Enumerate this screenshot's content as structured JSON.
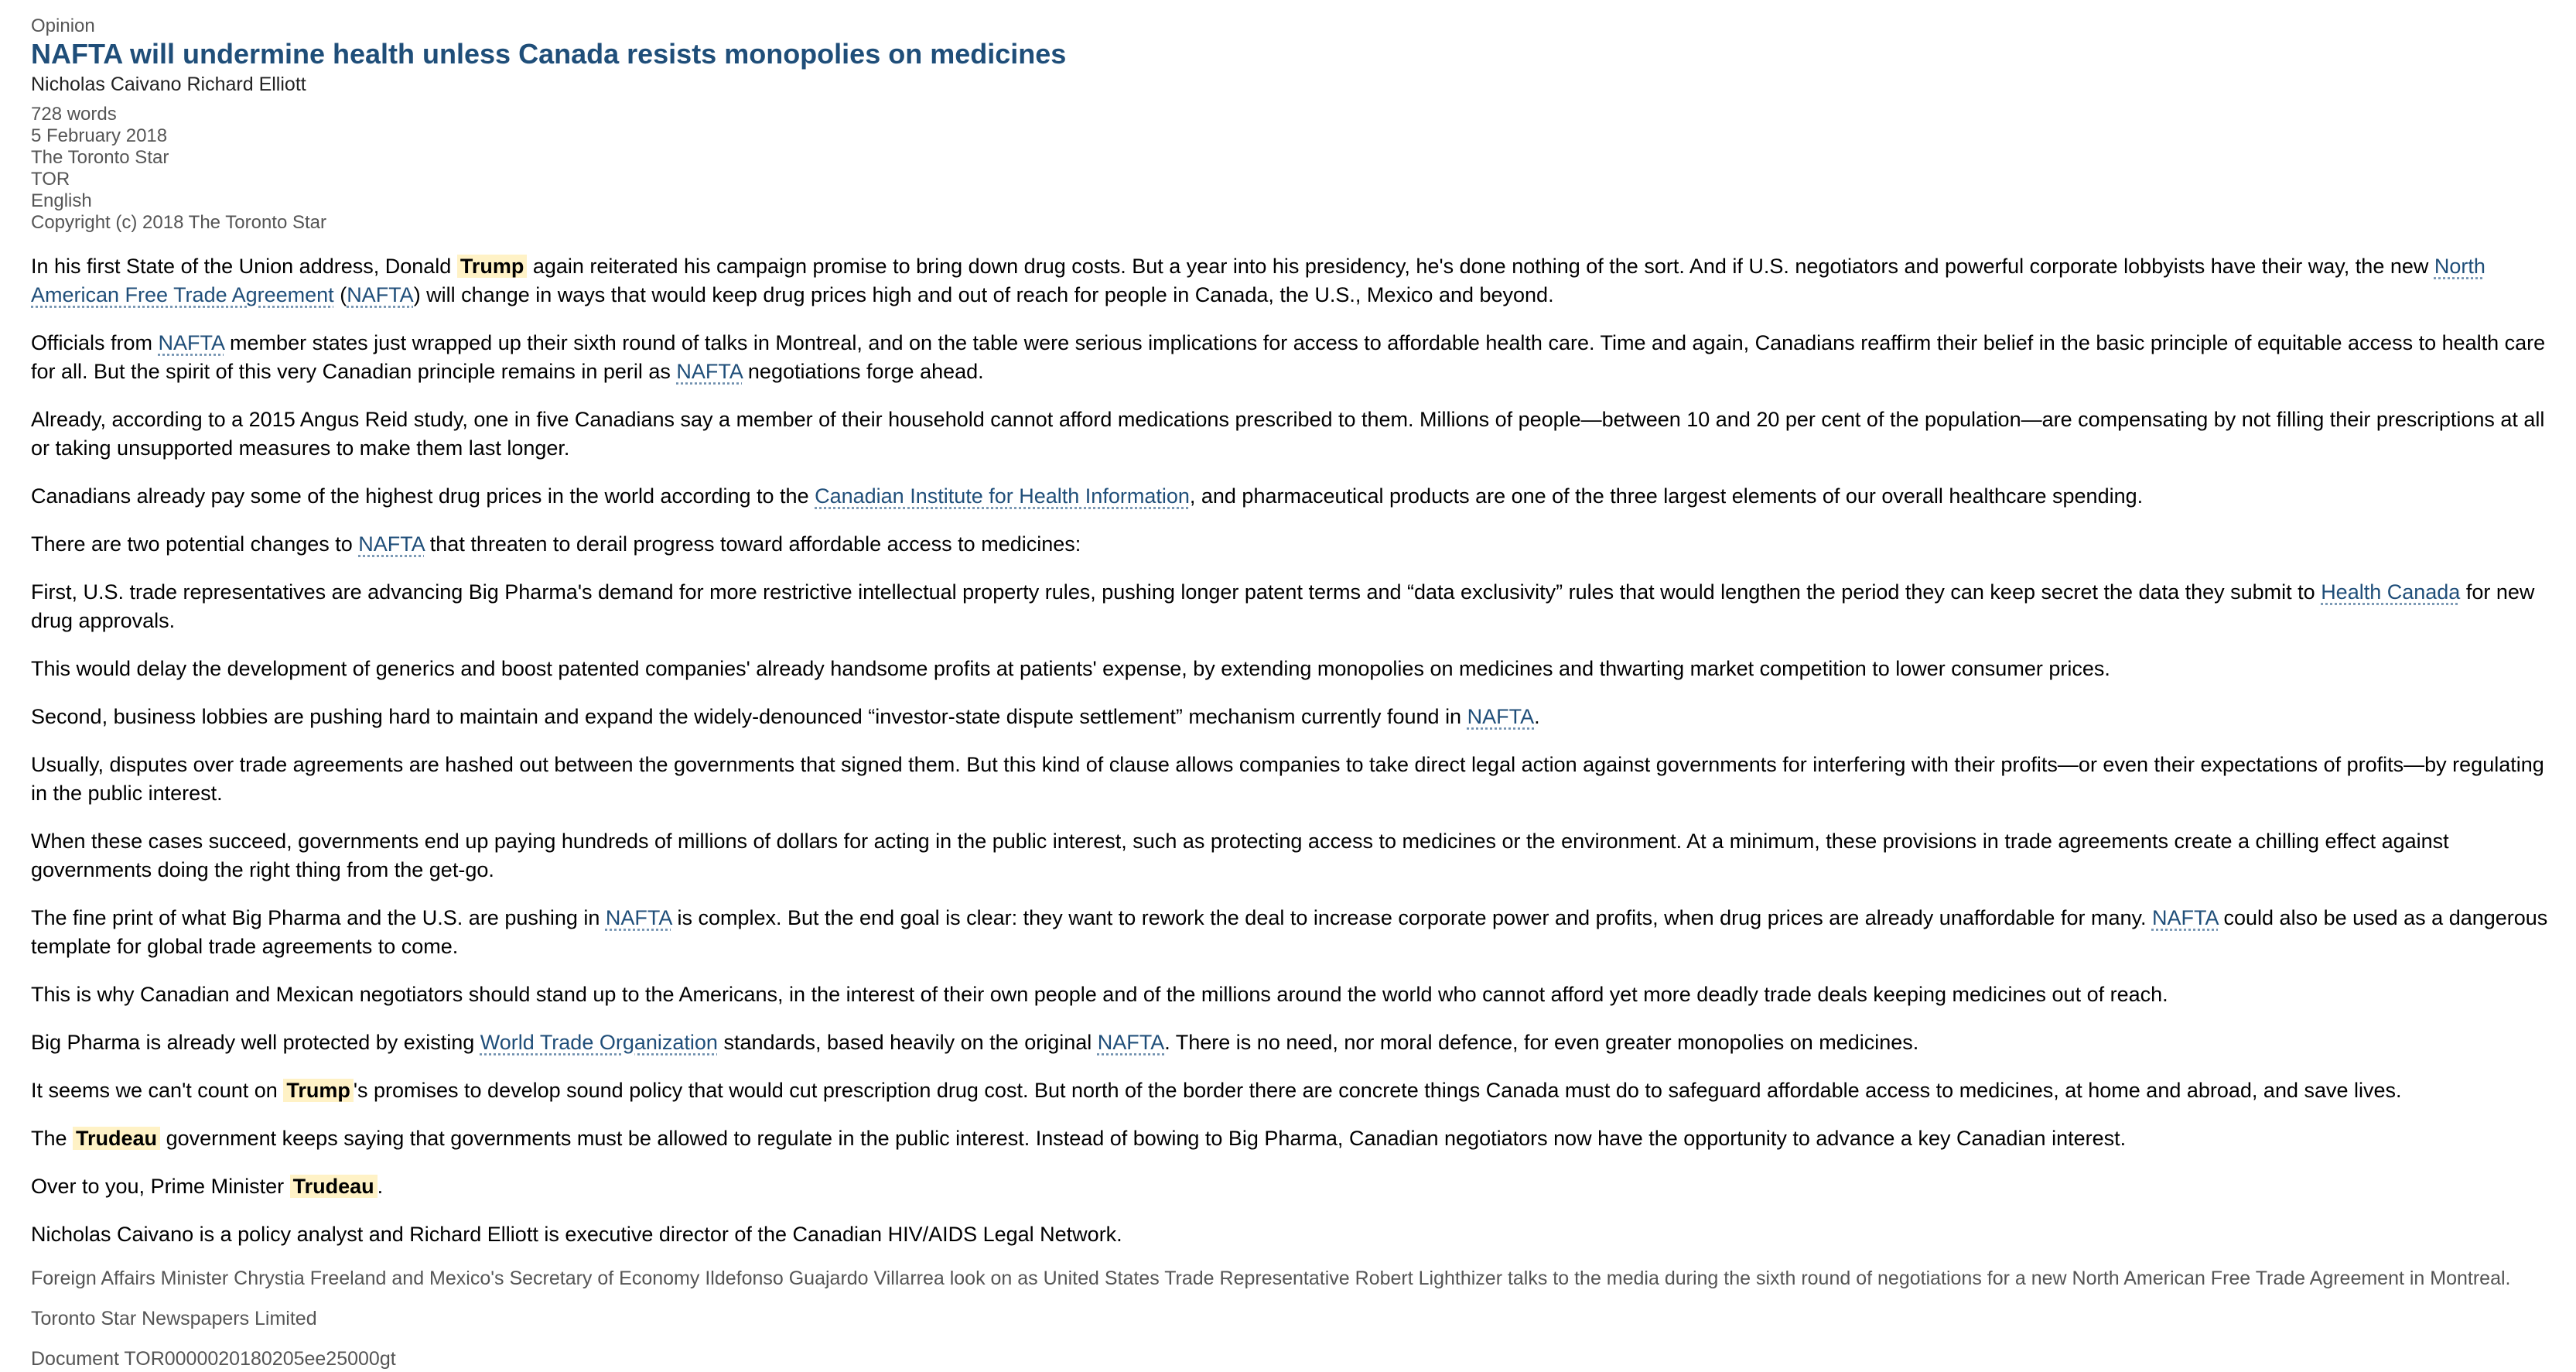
{
  "article": {
    "section": "Opinion",
    "headline": "NAFTA will undermine health unless Canada resists monopolies on medicines",
    "byline": "Nicholas Caivano Richard Elliott",
    "meta": {
      "word_count": "728 words",
      "date": "5 February 2018",
      "publication": "The Toronto Star",
      "source_code": "TOR",
      "language": "English",
      "copyright": "Copyright (c) 2018 The Toronto Star"
    },
    "paragraphs": {
      "p1": {
        "t1": "In his first State of the Union address, Donald ",
        "hl1": "Trump",
        "t2": " again reiterated his campaign promise to bring down drug costs. But a year into his presidency, he's done nothing of the sort. And if U.S. negotiators and powerful corporate lobbyists have their way, the new ",
        "link1": "North American Free Trade Agreement",
        "t3": " (",
        "link2": "NAFTA",
        "t4": ") will change in ways that would keep drug prices high and out of reach for people in Canada, the U.S., Mexico and beyond."
      },
      "p2": {
        "t1": "Officials from ",
        "link1": "NAFTA",
        "t2": " member states just wrapped up their sixth round of talks in Montreal, and on the table were serious implications for access to affordable health care. Time and again, Canadians reaffirm their belief in the basic principle of equitable access to health care for all. But the spirit of this very Canadian principle remains in peril as ",
        "link2": "NAFTA",
        "t3": " negotiations forge ahead."
      },
      "p3": {
        "t1": "Already, according to a 2015 Angus Reid study, one in five Canadians say a member of their household cannot afford medications prescribed to them. Millions of people—between 10 and 20 per cent of the population—are compensating by not filling their prescriptions at all or taking unsupported measures to make them last longer."
      },
      "p4": {
        "t1": "Canadians already pay some of the highest drug prices in the world according to the ",
        "link1": "Canadian Institute for Health Information",
        "t2": ", and pharmaceutical products are one of the three largest elements of our overall healthcare spending."
      },
      "p5": {
        "t1": "There are two potential changes to ",
        "link1": "NAFTA",
        "t2": " that threaten to derail progress toward affordable access to medicines:"
      },
      "p6": {
        "t1": "First, U.S. trade representatives are advancing Big Pharma's demand for more restrictive intellectual property rules, pushing longer patent terms and “data exclusivity” rules that would lengthen the period they can keep secret the data they submit to ",
        "link1": "Health Canada",
        "t2": " for new drug approvals."
      },
      "p7": {
        "t1": "This would delay the development of generics and boost patented companies' already handsome profits at patients' expense, by extending monopolies on medicines and thwarting market competition to lower consumer prices."
      },
      "p8": {
        "t1": "Second, business lobbies are pushing hard to maintain and expand the widely-denounced “investor-state dispute settlement” mechanism currently found in ",
        "link1": "NAFTA",
        "t2": "."
      },
      "p9": {
        "t1": "Usually, disputes over trade agreements are hashed out between the governments that signed them. But this kind of clause allows companies to take direct legal action against governments for interfering with their profits—or even their expectations of profits—by regulating in the public interest."
      },
      "p10": {
        "t1": "When these cases succeed, governments end up paying hundreds of millions of dollars for acting in the public interest, such as protecting access to medicines or the environment. At a minimum, these provisions in trade agreements create a chilling effect against governments doing the right thing from the get-go."
      },
      "p11": {
        "t1": "The fine print of what Big Pharma and the U.S. are pushing in ",
        "link1": "NAFTA",
        "t2": " is complex. But the end goal is clear: they want to rework the deal to increase corporate power and profits, when drug prices are already unaffordable for many. ",
        "link2": "NAFTA",
        "t3": " could also be used as a dangerous template for global trade agreements to come."
      },
      "p12": {
        "t1": "This is why Canadian and Mexican negotiators should stand up to the Americans, in the interest of their own people and of the millions around the world who cannot afford yet more deadly trade deals keeping medicines out of reach."
      },
      "p13": {
        "t1": "Big Pharma is already well protected by existing ",
        "link1": "World Trade Organization",
        "t2": " standards, based heavily on the original ",
        "link2": "NAFTA",
        "t3": ". There is no need, nor moral defence, for even greater monopolies on medicines."
      },
      "p14": {
        "t1": "It seems we can't count on ",
        "hl1": "Trump",
        "t2": "'s promises to develop sound policy that would cut prescription drug cost. But north of the border there are concrete things Canada must do to safeguard affordable access to medicines, at home and abroad, and save lives."
      },
      "p15": {
        "t1": "The ",
        "hl1": "Trudeau",
        "t2": " government keeps saying that governments must be allowed to regulate in the public interest. Instead of bowing to Big Pharma, Canadian negotiators now have the opportunity to advance a key Canadian interest."
      },
      "p16": {
        "t1": "Over to you, Prime Minister ",
        "hl1": "Trudeau",
        "t2": "."
      },
      "p17": {
        "t1": "Nicholas Caivano is a policy analyst and Richard Elliott is executive director of the Canadian HIV/AIDS Legal Network."
      }
    },
    "caption": "Foreign Affairs Minister Chrystia Freeland and Mexico's Secretary of Economy Ildefonso Guajardo Villarrea look on as United States Trade Representative Robert Lighthizer talks to the media during the sixth round of negotiations for a new North American Free Trade Agreement in Montreal.",
    "publisher": "Toronto Star Newspapers Limited",
    "document_id": "Document TOR0000020180205ee25000gt"
  },
  "colors": {
    "headline": "#1f4e79",
    "entity_link": "#1f4e79",
    "highlight": "#fff2c6",
    "meta_text": "#555555"
  }
}
